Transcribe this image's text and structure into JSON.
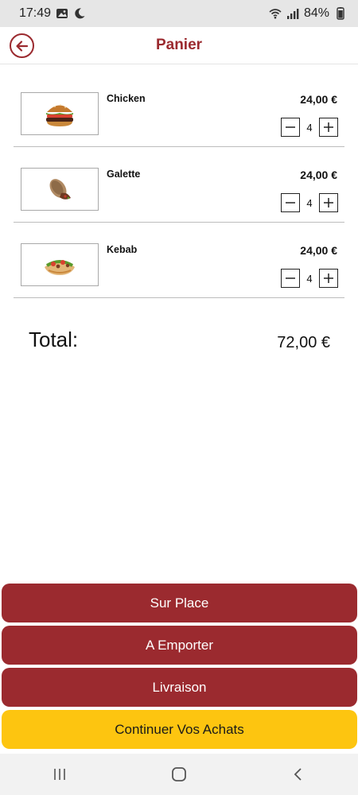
{
  "status_bar": {
    "time": "17:49",
    "battery": "84%",
    "icons": [
      "image-icon",
      "moon-icon",
      "wifi-icon",
      "signal-icon",
      "battery-icon"
    ]
  },
  "header": {
    "title": "Panier",
    "back_icon": "arrow-left-icon"
  },
  "cart": {
    "items": [
      {
        "name": "Chicken",
        "price": "24,00 €",
        "quantity": "4",
        "image": "burger-image"
      },
      {
        "name": "Galette",
        "price": "24,00 €",
        "quantity": "4",
        "image": "wrap-image"
      },
      {
        "name": "Kebab",
        "price": "24,00 €",
        "quantity": "4",
        "image": "kebab-image"
      }
    ]
  },
  "total": {
    "label": "Total:",
    "value": "72,00 €"
  },
  "actions": {
    "sur_place": "Sur Place",
    "a_emporter": "A Emporter",
    "livraison": "Livraison",
    "continuer": "Continuer Vos Achats"
  },
  "colors": {
    "brand": "#9b2a2f",
    "accent": "#fdc510",
    "status_bar": "#e6e6e6"
  },
  "nav_bar": {
    "icons": [
      "recent-apps-icon",
      "home-icon",
      "back-icon"
    ]
  }
}
